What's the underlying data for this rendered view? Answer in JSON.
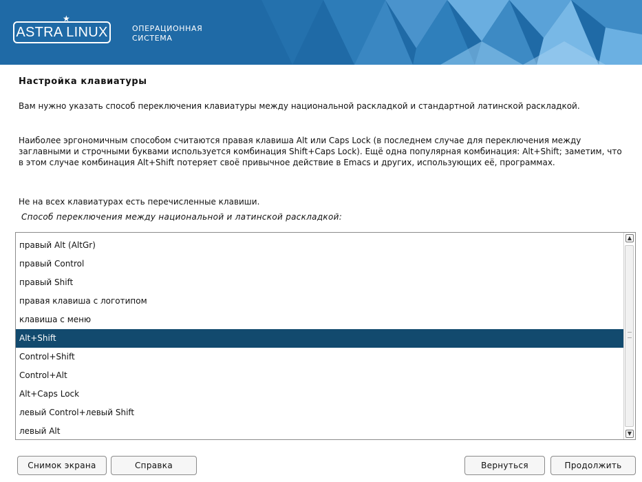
{
  "header": {
    "logo_text": "ASTRA LINUX",
    "subtitle_line1": "ОПЕРАЦИОННАЯ",
    "subtitle_line2": "СИСТЕМА"
  },
  "page": {
    "title": "Настройка клавиатуры",
    "paragraph1": "Вам нужно указать способ переключения клавиатуры между национальной раскладкой и стандартной латинской раскладкой.",
    "paragraph2": "Наиболее эргономичным способом считаются правая клавиша Alt или Caps Lock (в последнем случае для переключения между заглавными и строчными буквами используется комбинация Shift+Caps Lock). Ещё одна популярная комбинация: Alt+Shift; заметим, что в этом случае комбинация Alt+Shift потеряет своё привычное действие в Emacs и других, использующих её, программах.",
    "paragraph3": "Не на всех клавиатурах есть перечисленные клавиши.",
    "list_prompt": "Способ переключения между национальной и латинской раскладкой:"
  },
  "list": {
    "items": [
      "правый Alt (AltGr)",
      "правый Control",
      "правый Shift",
      "правая клавиша с логотипом",
      "клавиша с меню",
      "Alt+Shift",
      "Control+Shift",
      "Control+Alt",
      "Alt+Caps Lock",
      "левый Control+левый Shift",
      "левый Alt"
    ],
    "selected": "Alt+Shift"
  },
  "buttons": {
    "screenshot": "Снимок экрана",
    "help": "Справка",
    "back": "Вернуться",
    "continue": "Продолжить"
  },
  "colors": {
    "header_bg": "#1f6aa6",
    "selection_bg": "#124a6e",
    "selection_fg": "#ffffff"
  },
  "icons": {
    "scroll_up": "chevron-up-icon",
    "scroll_down": "chevron-down-icon",
    "logo_star": "star-icon"
  }
}
